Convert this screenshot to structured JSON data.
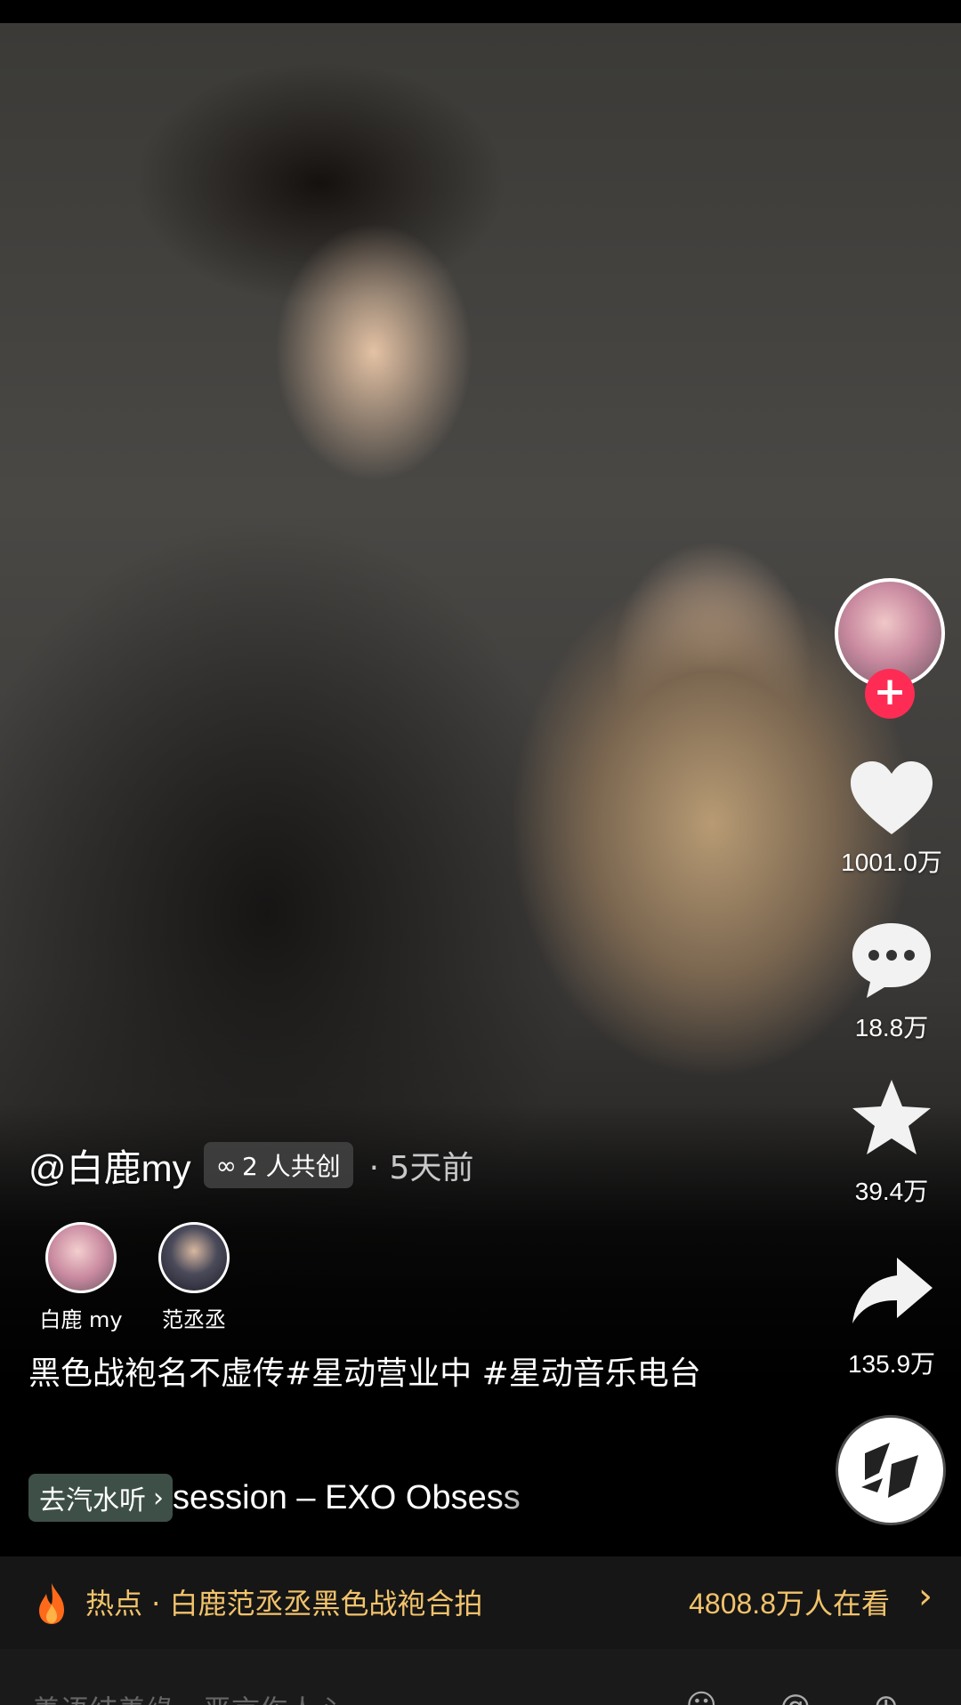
{
  "author": {
    "handle": "@白鹿my",
    "time_ago": "· 5天前"
  },
  "cocreate": {
    "icon": "co-create-icon",
    "label": "2 人共创"
  },
  "collaborators": [
    {
      "name": "白鹿 my"
    },
    {
      "name": "范丞丞"
    }
  ],
  "caption": "黑色战袍名不虚传#星动营业中 #星动音乐电台",
  "music": {
    "button_label": "去汽水听",
    "chevron": "›",
    "title": "session – EXO    Obsess"
  },
  "rail": {
    "likes": "1001.0万",
    "comments": "18.8万",
    "favorites": "39.4万",
    "shares": "135.9万",
    "follow_symbol": "+"
  },
  "hot": {
    "label": "热点 · 白鹿范丞丞黑色战袍合拍",
    "viewers": "4808.8万人在看",
    "chevron": "›"
  },
  "bottom": {
    "comment_hint": "善语结善缘，恶言伤人心",
    "icons": "☺ @ ⊕"
  },
  "colors": {
    "accent": "#fe2c55",
    "hot_text": "#f2c36b",
    "music_btn": "#3e4f47"
  }
}
